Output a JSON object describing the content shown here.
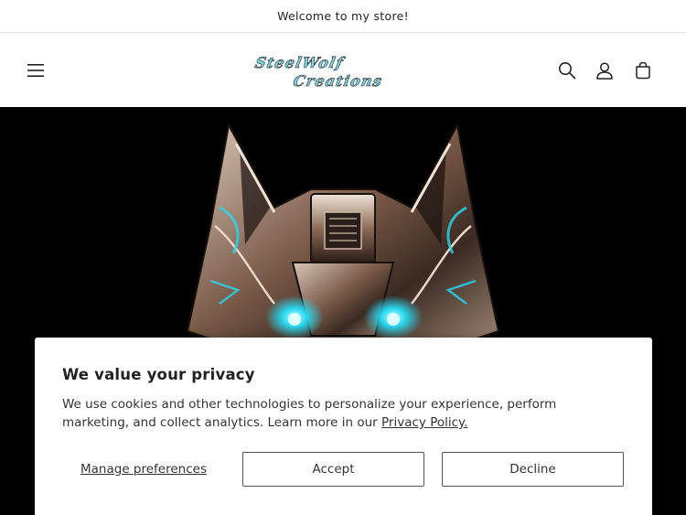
{
  "announcement": {
    "text": "Welcome to my store!"
  },
  "header": {
    "logo": {
      "line1": "SteelWolf",
      "line2": "Creations"
    },
    "icons": [
      "menu-icon",
      "search-icon",
      "account-icon",
      "cart-icon"
    ]
  },
  "consent": {
    "title": "We value your privacy",
    "body": "We use cookies and other technologies to personalize your experience, perform marketing, and collect analytics. Learn more in our ",
    "link_text": "Privacy Policy.",
    "manage_label": "Manage preferences",
    "accept_label": "Accept",
    "decline_label": "Decline"
  },
  "colors": {
    "logo_fill": "#7fd6e6",
    "logo_stroke": "#1a1a1a",
    "hero_bg": "#000000",
    "eye_glow": "#28d8f0"
  }
}
